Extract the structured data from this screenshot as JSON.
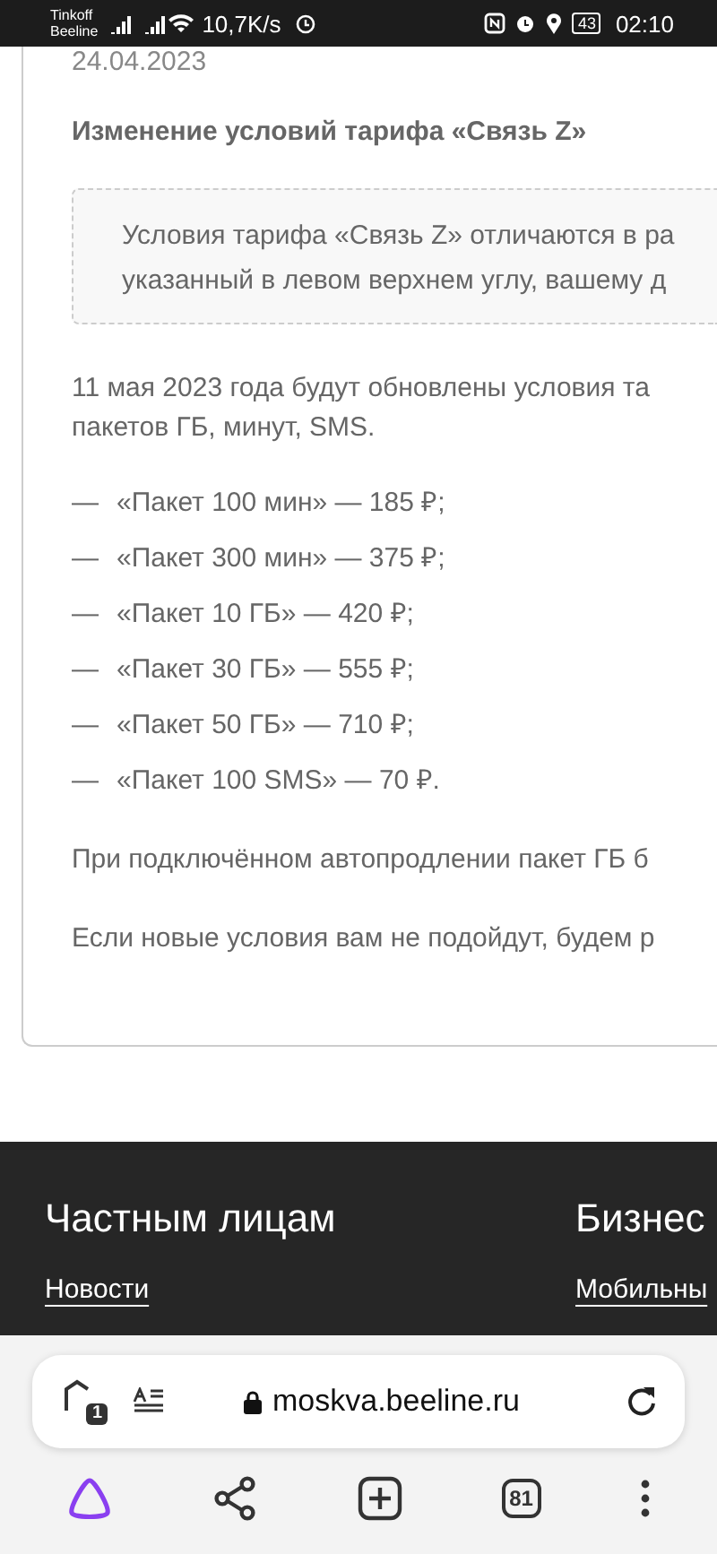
{
  "status_bar": {
    "carriers": [
      "Tinkoff",
      "Beeline"
    ],
    "speed": "10,7K/s",
    "battery": "43",
    "time": "02:10"
  },
  "article": {
    "date": "24.04.2023",
    "title": "Изменение условий тарифа «Связь Z»",
    "notice": [
      "Условия тарифа «Связь Z» отличаются в ра",
      "указанный в левом верхнем углу, вашему д"
    ],
    "intro": [
      "11 мая 2023 года будут обновлены условия та",
      "пакетов ГБ, минут, SMS."
    ],
    "packages": [
      {
        "marker": "—",
        "text": "«Пакет 100 мин» — 185 ₽;"
      },
      {
        "marker": "—",
        "text": "«Пакет 300 мин» — 375 ₽;"
      },
      {
        "marker": "—",
        "text": "«Пакет 10 ГБ» — 420 ₽;"
      },
      {
        "marker": "—",
        "text": "«Пакет 30 ГБ» — 555 ₽;"
      },
      {
        "marker": "—",
        "text": "«Пакет 50 ГБ» — 710 ₽;"
      },
      {
        "marker": "—",
        "text": "«Пакет 100 SMS» — 70 ₽."
      }
    ],
    "paragraphs": [
      "При подключённом автопродлении пакет ГБ б",
      "Если новые условия вам не подойдут, будем р"
    ]
  },
  "footer": {
    "columns": [
      {
        "heading": "Частным лицам",
        "link": "Новости"
      },
      {
        "heading": "Бизнес",
        "link": "Мобильны"
      }
    ]
  },
  "browser": {
    "tab_badge": "1",
    "url": "moskva.beeline.ru",
    "tabs_count": "81"
  }
}
